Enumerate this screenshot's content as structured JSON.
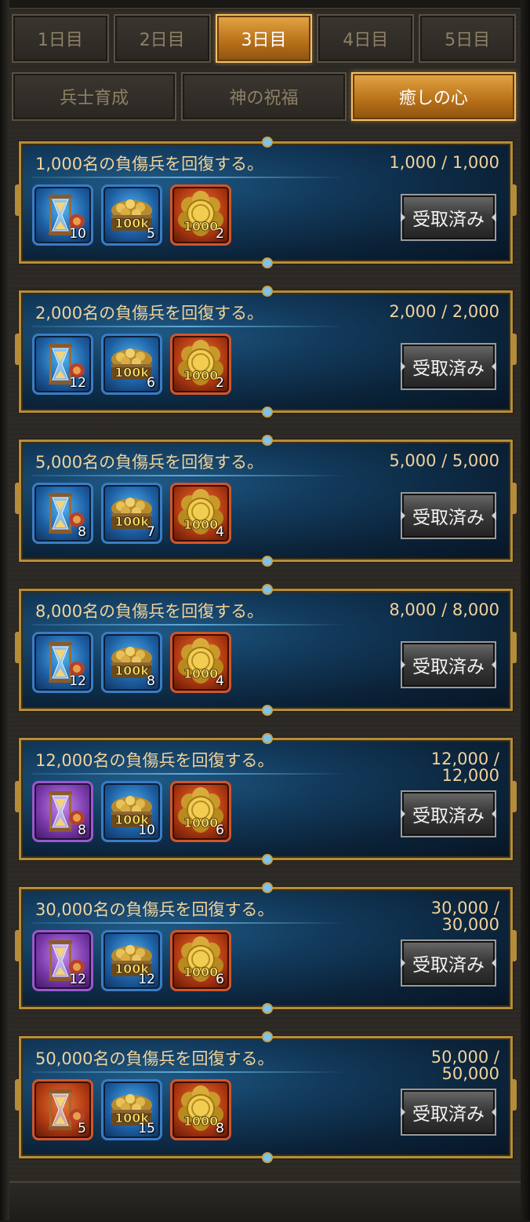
{
  "day_tabs": [
    {
      "label": "1日目",
      "active": false
    },
    {
      "label": "2日目",
      "active": false
    },
    {
      "label": "3日目",
      "active": true
    },
    {
      "label": "4日目",
      "active": false
    },
    {
      "label": "5日目",
      "active": false
    }
  ],
  "category_tabs": [
    {
      "label": "兵士育成",
      "active": false
    },
    {
      "label": "神の祝福",
      "active": false
    },
    {
      "label": "癒しの心",
      "active": true
    }
  ],
  "quests": [
    {
      "title": "1,000名の負傷兵を回復する。",
      "progress": "1,000 / 1,000",
      "button": "受取済み",
      "rewards": [
        {
          "icon": "hourglass-icon",
          "frame": "blue",
          "qty": "10"
        },
        {
          "icon": "gold-chest-100k-icon",
          "frame": "blue",
          "qty": "5"
        },
        {
          "icon": "gold-coins-1000-icon",
          "frame": "orange",
          "qty": "2"
        }
      ]
    },
    {
      "title": "2,000名の負傷兵を回復する。",
      "progress": "2,000 / 2,000",
      "button": "受取済み",
      "rewards": [
        {
          "icon": "hourglass-icon",
          "frame": "blue",
          "qty": "12"
        },
        {
          "icon": "gold-chest-100k-icon",
          "frame": "blue",
          "qty": "6"
        },
        {
          "icon": "gold-coins-1000-icon",
          "frame": "orange",
          "qty": "2"
        }
      ]
    },
    {
      "title": "5,000名の負傷兵を回復する。",
      "progress": "5,000 / 5,000",
      "button": "受取済み",
      "rewards": [
        {
          "icon": "hourglass-icon",
          "frame": "blue",
          "qty": "8"
        },
        {
          "icon": "gold-chest-100k-icon",
          "frame": "blue",
          "qty": "7"
        },
        {
          "icon": "gold-coins-1000-icon",
          "frame": "orange",
          "qty": "4"
        }
      ]
    },
    {
      "title": "8,000名の負傷兵を回復する。",
      "progress": "8,000 / 8,000",
      "button": "受取済み",
      "rewards": [
        {
          "icon": "hourglass-icon",
          "frame": "blue",
          "qty": "12"
        },
        {
          "icon": "gold-chest-100k-icon",
          "frame": "blue",
          "qty": "8"
        },
        {
          "icon": "gold-coins-1000-icon",
          "frame": "orange",
          "qty": "4"
        }
      ]
    },
    {
      "title": "12,000名の負傷兵を回復する。",
      "progress": "12,000 / 12,000",
      "button": "受取済み",
      "rewards": [
        {
          "icon": "hourglass-icon",
          "frame": "purple",
          "qty": "8"
        },
        {
          "icon": "gold-chest-100k-icon",
          "frame": "blue",
          "qty": "10"
        },
        {
          "icon": "gold-coins-1000-icon",
          "frame": "orange",
          "qty": "6"
        }
      ]
    },
    {
      "title": "30,000名の負傷兵を回復する。",
      "progress": "30,000 / 30,000",
      "button": "受取済み",
      "rewards": [
        {
          "icon": "hourglass-icon",
          "frame": "purple",
          "qty": "12"
        },
        {
          "icon": "gold-chest-100k-icon",
          "frame": "blue",
          "qty": "12"
        },
        {
          "icon": "gold-coins-1000-icon",
          "frame": "orange",
          "qty": "6"
        }
      ]
    },
    {
      "title": "50,000名の負傷兵を回復する。",
      "progress": "50,000 / 50,000",
      "button": "受取済み",
      "rewards": [
        {
          "icon": "hourglass-icon",
          "frame": "orange",
          "qty": "5"
        },
        {
          "icon": "gold-chest-100k-icon",
          "frame": "blue",
          "qty": "15"
        },
        {
          "icon": "gold-coins-1000-icon",
          "frame": "orange",
          "qty": "8"
        }
      ]
    }
  ],
  "item_labels": {
    "chest": "100k",
    "coins": "1000"
  },
  "colors": {
    "accent_gold": "#b58d3a",
    "active_tab": "#d08a2a",
    "title_text": "#f2d29a"
  }
}
